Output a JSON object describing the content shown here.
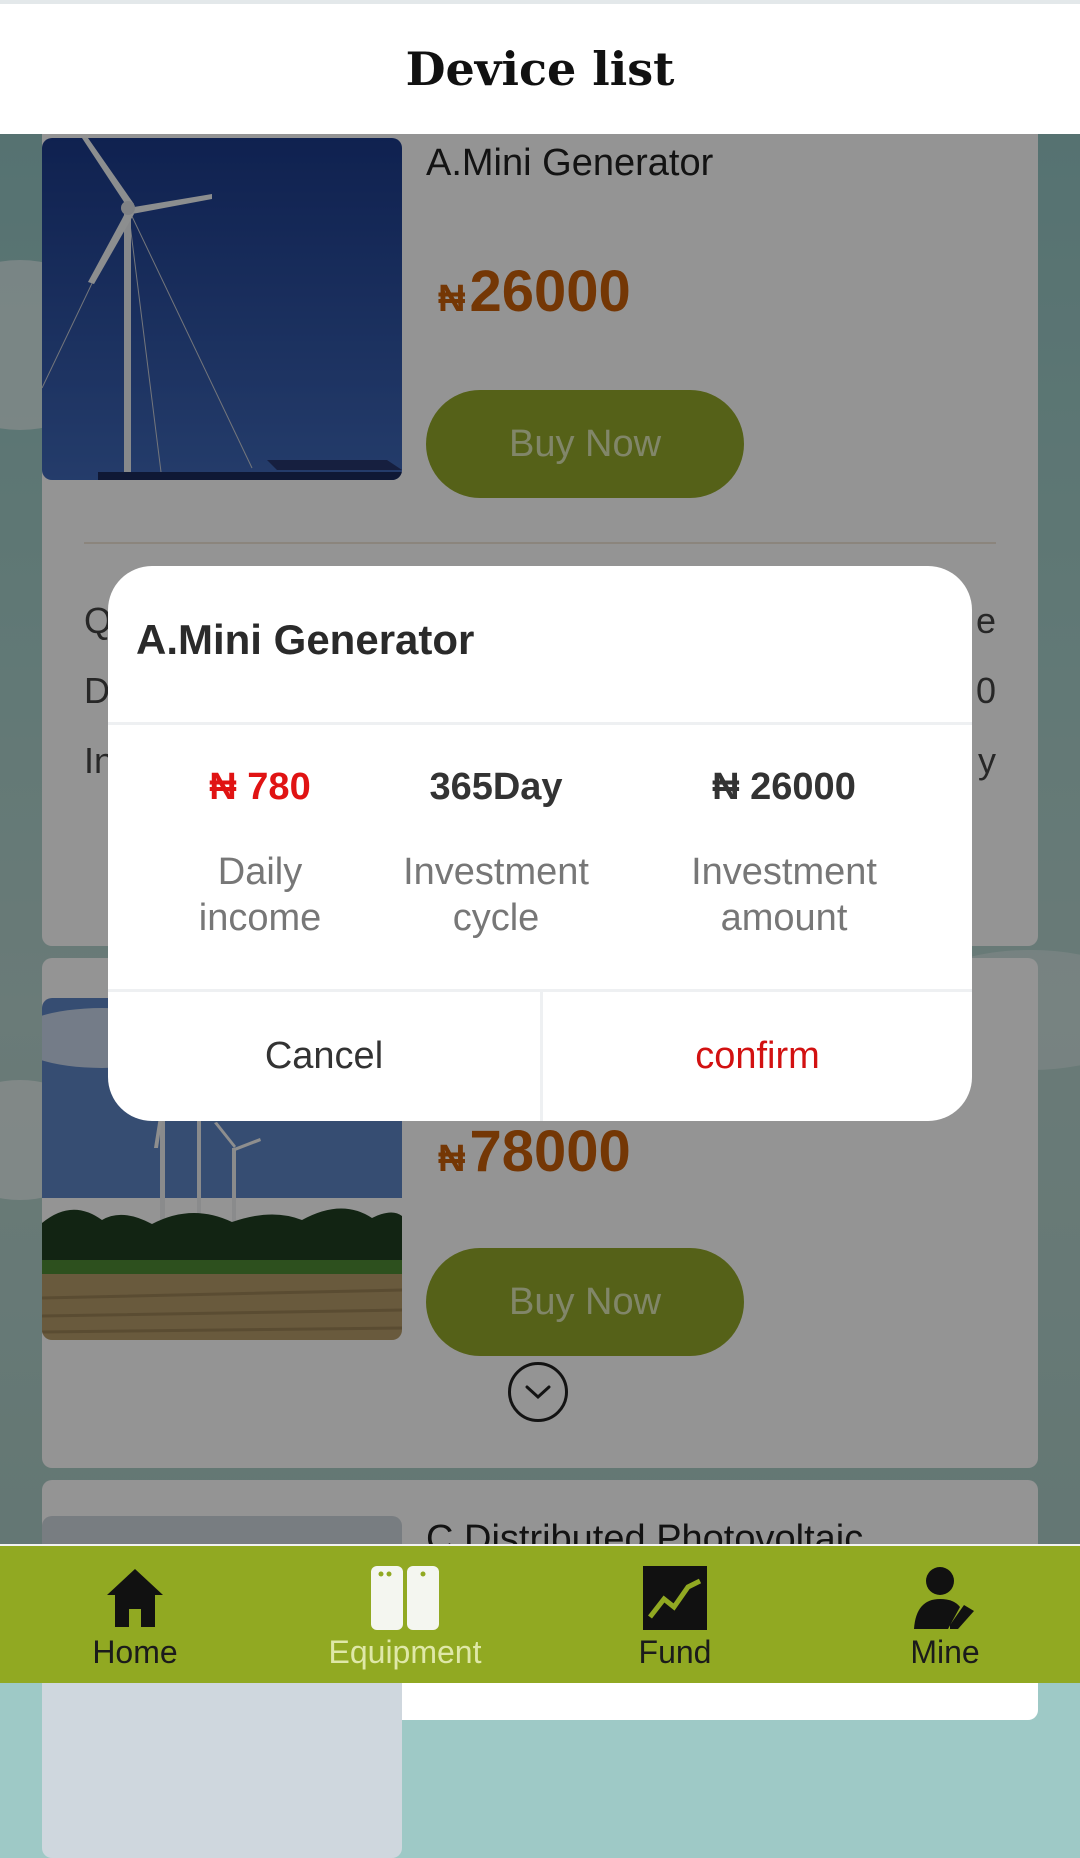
{
  "header": {
    "title": "Device list"
  },
  "products": [
    {
      "name": "A.Mini Generator",
      "currency": "₦",
      "price": "26000",
      "buy_label": "Buy Now",
      "details": [
        {
          "label": "Q",
          "value": "e"
        },
        {
          "label": "D",
          "value": "0"
        },
        {
          "label": "In",
          "value": "y"
        }
      ]
    },
    {
      "currency": "₦",
      "price": "78000",
      "buy_label": "Buy Now"
    },
    {
      "name": "C.Distributed Photovoltaic"
    }
  ],
  "dialog": {
    "title": "A.Mini Generator",
    "stats": [
      {
        "value": "₦ 780",
        "label": "Daily income"
      },
      {
        "value": "365Day",
        "label": "Investment cycle"
      },
      {
        "value": "₦ 26000",
        "label": "Investment amount"
      }
    ],
    "cancel_label": "Cancel",
    "confirm_label": "confirm"
  },
  "tabbar": {
    "items": [
      {
        "label": "Home",
        "icon": "home-icon"
      },
      {
        "label": "Equipment",
        "icon": "equipment-icon"
      },
      {
        "label": "Fund",
        "icon": "fund-chart-icon"
      },
      {
        "label": "Mine",
        "icon": "user-edit-icon"
      }
    ],
    "active": "Equipment"
  },
  "colors": {
    "accent_green": "#91a922",
    "price_orange": "#c95f0a",
    "confirm_red": "#d21111"
  }
}
